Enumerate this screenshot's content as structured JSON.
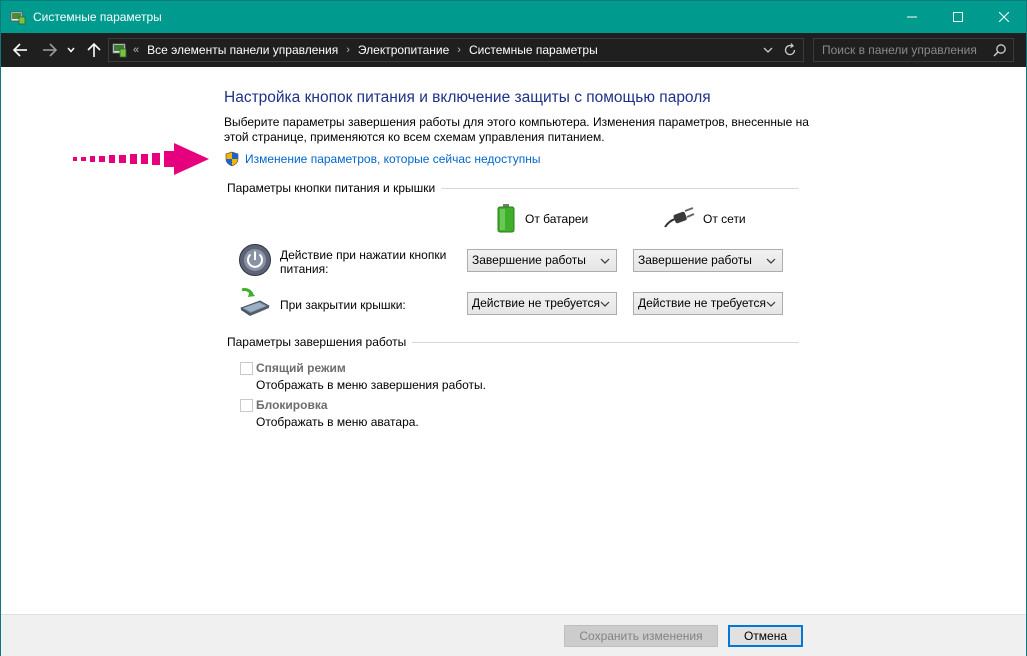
{
  "window": {
    "title": "Системные параметры",
    "controls": {
      "minimize": "minimize",
      "maximize": "maximize",
      "close": "close"
    }
  },
  "address_bar": {
    "lead": "«",
    "breadcrumbs": [
      "Все элементы панели управления",
      "Электропитание",
      "Системные параметры"
    ],
    "separator": "›"
  },
  "search": {
    "placeholder": "Поиск в панели управления"
  },
  "page": {
    "heading": "Настройка кнопок питания и включение защиты с помощью пароля",
    "description": "Выберите параметры завершения работы для этого компьютера. Изменения параметров, внесенные на этой странице, применяются ко всем схемам управления питанием.",
    "change_link": "Изменение параметров, которые сейчас недоступны"
  },
  "power_group": {
    "title": "Параметры кнопки питания и крышки",
    "col_battery": "От батареи",
    "col_ac": "От сети",
    "rows": [
      {
        "label": "Действие при нажатии кнопки питания:",
        "battery": "Завершение работы",
        "ac": "Завершение работы"
      },
      {
        "label": "При закрытии крышки:",
        "battery": "Действие не требуется",
        "ac": "Действие не требуется"
      }
    ]
  },
  "shutdown_group": {
    "title": "Параметры завершения работы",
    "items": [
      {
        "label": "Спящий режим",
        "desc": "Отображать в меню завершения работы.",
        "checked": false
      },
      {
        "label": "Блокировка",
        "desc": "Отображать в меню аватара.",
        "checked": false
      }
    ]
  },
  "footer": {
    "save_label": "Сохранить изменения",
    "cancel_label": "Отмена"
  },
  "colors": {
    "titlebar": "#009b8f",
    "heading": "#1e3287",
    "link": "#0066cc",
    "arrow": "#e6007e"
  }
}
